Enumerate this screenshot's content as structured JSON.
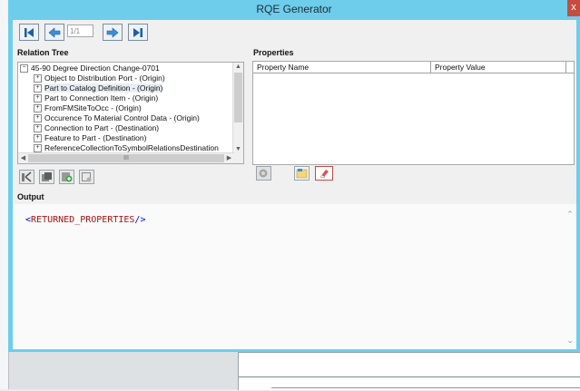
{
  "window": {
    "title": "RQE Generator",
    "close_glyph": "x"
  },
  "toolbar": {
    "first_icon": "first-page-icon",
    "prev_icon": "previous-page-icon",
    "page_value": "1/1",
    "next_icon": "next-page-icon",
    "last_icon": "last-page-icon"
  },
  "relation_tree": {
    "label": "Relation Tree",
    "root": {
      "expander": "⊟",
      "label": "45-90 Degree Direction Change-0701"
    },
    "items": [
      {
        "expander": "⊞",
        "label": "Object to Distribution Port - (Origin)"
      },
      {
        "expander": "⊞",
        "label": "Part to Catalog Definition - (Origin)"
      },
      {
        "expander": "⊞",
        "label": "Part to Connection Item - (Origin)"
      },
      {
        "expander": "⊞",
        "label": "FromFMSiteToOcc - (Origin)"
      },
      {
        "expander": "⊞",
        "label": "Occurence To Material Control Data - (Origin)"
      },
      {
        "expander": "⊞",
        "label": "Connection to Part - (Destination)"
      },
      {
        "expander": "⊞",
        "label": "Feature to Part - (Destination)"
      },
      {
        "expander": "⊞",
        "label": "ReferenceCollectionToSymbolRelationsDestination"
      }
    ],
    "hscroll_mid": "III"
  },
  "properties": {
    "label": "Properties",
    "columns": [
      "Property Name",
      "Property Value"
    ]
  },
  "tree_buttons": [
    "add-relation-icon",
    "copy-icon",
    "add-item-icon",
    "clear-icon"
  ],
  "prop_buttons": [
    "refresh-icon",
    "open-file-icon",
    "eraser-icon"
  ],
  "output": {
    "label": "Output",
    "open_bracket": "<",
    "tag": "RETURNED_PROPERTIES",
    "close_bracket": "/>"
  },
  "colors": {
    "window_frame": "#6dcdeb",
    "close_button": "#c74c40",
    "xml_tag": "#a31515",
    "xml_bracket": "#0000ff"
  }
}
